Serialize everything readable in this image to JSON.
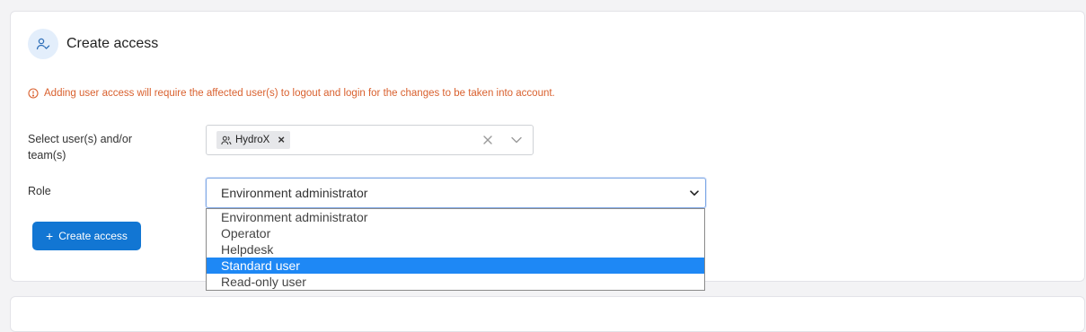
{
  "header": {
    "title": "Create access",
    "icon": "user-check-icon"
  },
  "warning": {
    "text": "Adding user access will require the affected user(s) to logout and login for the changes to be taken into account.",
    "color": "#d9612f",
    "icon": "info-circle-icon"
  },
  "users_field": {
    "label": "Select user(s) and/or team(s)",
    "chips": [
      {
        "label": "HydroX",
        "icon": "users-icon"
      }
    ]
  },
  "role_field": {
    "label": "Role",
    "selected_value": "Environment administrator",
    "options": [
      "Environment administrator",
      "Operator",
      "Helpdesk",
      "Standard user",
      "Read-only user"
    ],
    "highlighted_option": "Standard user"
  },
  "actions": {
    "create_label": "Create access",
    "accent": "#1276d3"
  }
}
